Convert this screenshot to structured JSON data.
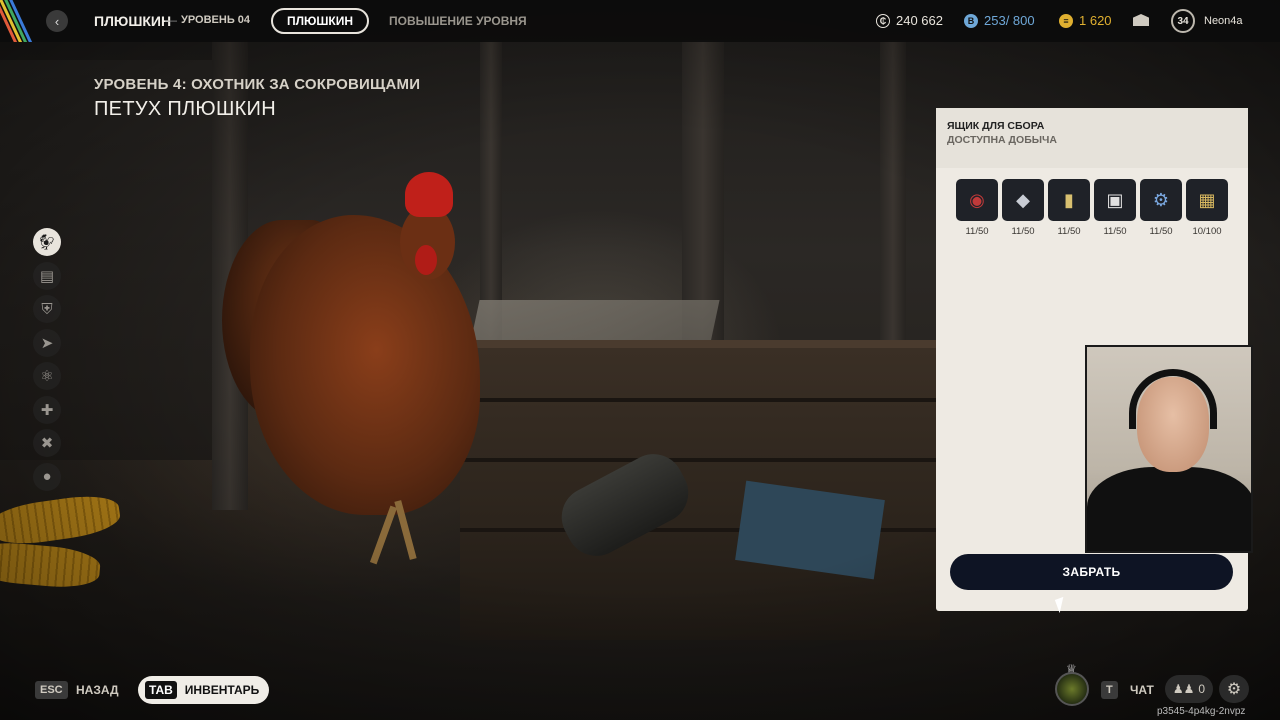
{
  "header": {
    "breadcrumb_main": "ПЛЮШКИН",
    "breadcrumb_separator": "—",
    "breadcrumb_level": "УРОВЕНЬ 04",
    "tabs": [
      {
        "label": "ПЛЮШКИН",
        "active": true
      },
      {
        "label": "ПОВЫШЕНИЕ УРОВНЯ",
        "active": false
      }
    ],
    "currencies": [
      {
        "icon": "coin-icon",
        "value": "240 662",
        "color": "#e8e4dc"
      },
      {
        "icon": "bond-icon",
        "value": "253/ 800",
        "color": "#6fa8d8"
      },
      {
        "icon": "scrip-icon",
        "value": "1 620",
        "color": "#e0b030"
      }
    ],
    "mail_icon": "mail-icon",
    "player_level": "34",
    "username": "Neon4a"
  },
  "main": {
    "level_title": "УРОВЕНЬ 4: ОХОТНИК ЗА СОКРОВИЩАМИ",
    "subject_title": "ПЕТУХ ПЛЮШКИН"
  },
  "sidebar": {
    "items": [
      {
        "icon": "rooster-icon",
        "active": true
      },
      {
        "icon": "workbench-icon",
        "active": false
      },
      {
        "icon": "shield-icon",
        "active": false
      },
      {
        "icon": "upgrade-icon",
        "active": false
      },
      {
        "icon": "atom-icon",
        "active": false
      },
      {
        "icon": "medkit-icon",
        "active": false
      },
      {
        "icon": "tools-icon",
        "active": false
      },
      {
        "icon": "grenade-icon",
        "active": false
      }
    ]
  },
  "loot_panel": {
    "title": "ЯЩИК ДЛЯ СБОРА",
    "subtitle": "ДОСТУПНА ДОБЫЧА",
    "items": [
      {
        "icon": "cable-icon",
        "count": "11/50"
      },
      {
        "icon": "metal-sheet-icon",
        "count": "11/50"
      },
      {
        "icon": "canister-icon",
        "count": "11/50"
      },
      {
        "icon": "device-icon",
        "count": "11/50"
      },
      {
        "icon": "electronics-icon",
        "count": "11/50"
      },
      {
        "icon": "scrap-box-icon",
        "count": "10/100"
      }
    ],
    "collect_label": "ЗАБРАТЬ"
  },
  "footer": {
    "esc_key": "ESC",
    "back_label": "НАЗАД",
    "tab_key": "TAB",
    "inventory_label": "ИНВЕНТАРЬ",
    "chat_key": "T",
    "chat_label": "ЧАТ",
    "friends_count": "0",
    "session_id": "p3545-4p4kg-2nvpz"
  }
}
